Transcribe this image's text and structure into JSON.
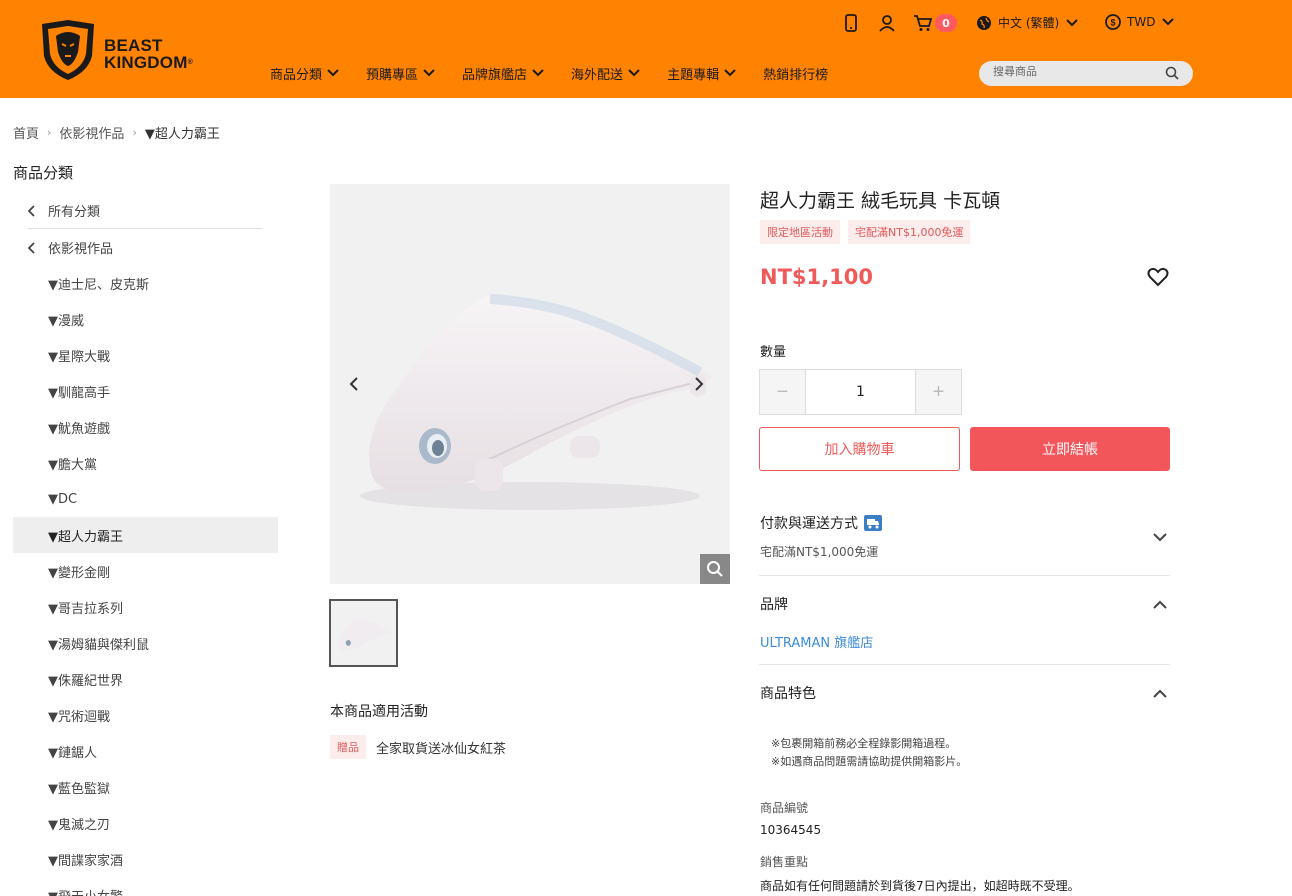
{
  "brand": {
    "line1": "BEAST",
    "line2": "KINGDOM",
    "reg": "®"
  },
  "header": {
    "cart_count": "0",
    "language": "中文 (繁體)",
    "currency": "TWD",
    "nav": [
      "商品分類",
      "預購專區",
      "品牌旗艦店",
      "海外配送",
      "主題專輯",
      "熱銷排行榜"
    ],
    "search_placeholder": "搜尋商品"
  },
  "breadcrumb": [
    "首頁",
    "依影視作品",
    "▼超人力霸王"
  ],
  "sidebar": {
    "title": "商品分類",
    "back_all": "所有分類",
    "back_parent": "依影視作品",
    "items": [
      "▼迪士尼、皮克斯",
      "▼漫威",
      "▼星際大戰",
      "▼馴龍高手",
      "▼魷魚遊戲",
      "▼膽大黨",
      "▼DC",
      "▼超人力霸王",
      "▼變形金剛",
      "▼哥吉拉系列",
      "▼湯姆貓與傑利鼠",
      "▼侏羅紀世界",
      "▼咒術迴戰",
      "▼鏈鋸人",
      "▼藍色監獄",
      "▼鬼滅之刃",
      "▼間諜家家酒",
      "▼飛天小女警"
    ],
    "active_index": 7
  },
  "promo": {
    "title": "本商品適用活動",
    "tag": "贈品",
    "text": "全家取貨送冰仙女紅茶"
  },
  "product": {
    "title": "超人力霸王 絨毛玩具 卡瓦頓",
    "tags": [
      "限定地區活動",
      "宅配滿NT$1,000免運"
    ],
    "price": "NT$1,100",
    "qty_label": "數量",
    "qty_value": "1",
    "add_cart": "加入購物車",
    "buy_now": "立即結帳",
    "shipping_title": "付款與運送方式",
    "shipping_sub": "宅配滿NT$1,000免運",
    "brand_title": "品牌",
    "brand_link": "ULTRAMAN 旗艦店",
    "features_title": "商品特色",
    "notes": [
      "※包裹開箱前務必全程錄影開箱過程。",
      "※如遇商品問題需請協助提供開箱影片。"
    ],
    "sku_label": "商品編號",
    "sku": "10364545",
    "sales_label": "銷售重點",
    "sales_text": "商品如有任何問題請於到貨後7日內提出，如超時既不受理。"
  },
  "colors": {
    "header": "#ff8200",
    "accent": "#f2565b",
    "link": "#3d8cd8"
  }
}
